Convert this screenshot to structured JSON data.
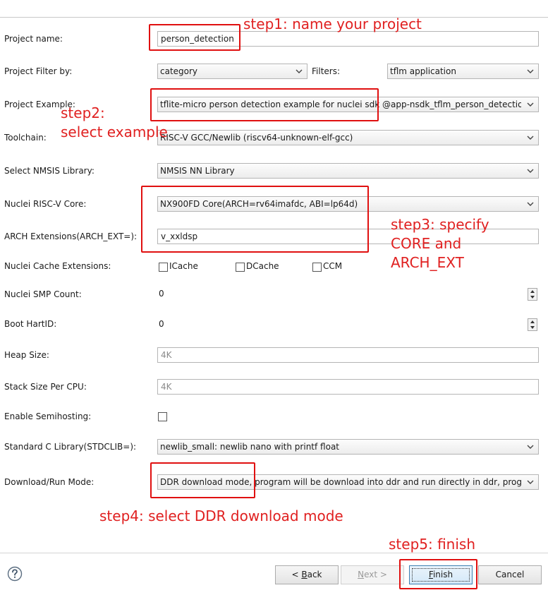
{
  "form": {
    "project_name": {
      "label": "Project name:",
      "value": "person_detection"
    },
    "project_filter": {
      "label": "Project Filter by:",
      "value": "category",
      "filters_label": "Filters:",
      "filters_value": "tflm application"
    },
    "project_example": {
      "label": "Project Example:",
      "value": "tflite-micro person detection example for nuclei sdk  @app-nsdk_tflm_person_detection"
    },
    "toolchain": {
      "label": "Toolchain:",
      "value": "RISC-V GCC/Newlib (riscv64-unknown-elf-gcc)"
    },
    "nmsis_library": {
      "label": "Select NMSIS Library:",
      "value": "NMSIS NN Library"
    },
    "core": {
      "label": "Nuclei RISC-V Core:",
      "value": "NX900FD Core(ARCH=rv64imafdc, ABI=lp64d)"
    },
    "arch_ext": {
      "label": "ARCH Extensions(ARCH_EXT=):",
      "value": "v_xxldsp"
    },
    "cache": {
      "label": "Nuclei Cache Extensions:",
      "options": [
        "ICache",
        "DCache",
        "CCM"
      ]
    },
    "smp_count": {
      "label": "Nuclei SMP Count:",
      "value": "0"
    },
    "boot_hartid": {
      "label": "Boot HartID:",
      "value": "0"
    },
    "heap_size": {
      "label": "Heap Size:",
      "value": "4K"
    },
    "stack_size": {
      "label": "Stack Size Per CPU:",
      "value": "4K"
    },
    "semihosting": {
      "label": "Enable Semihosting:",
      "checked": false
    },
    "stdclib": {
      "label": "Standard C Library(STDCLIB=):",
      "value": "newlib_small: newlib nano with printf float"
    },
    "download_mode": {
      "label": "Download/Run Mode:",
      "value": "DDR download mode, program will be download into ddr and run directly in ddr, program"
    }
  },
  "annotations": {
    "step1": "step1: name your project",
    "step2_line1": "step2:",
    "step2_line2": "select example",
    "step3_line1": "step3: specify",
    "step3_line2": "CORE and",
    "step3_line3": "ARCH_EXT",
    "step4": "step4: select DDR download mode",
    "step5": "step5: finish"
  },
  "buttons": {
    "back": {
      "prefix": "< ",
      "mnemonic": "B",
      "rest": "ack"
    },
    "next": {
      "mnemonic": "N",
      "rest": "ext >"
    },
    "finish": {
      "mnemonic": "F",
      "rest": "inish"
    },
    "cancel": "Cancel"
  },
  "icons": {
    "help": "help-icon",
    "dropdown": "chevron-down-icon",
    "spinner": "spinner-arrows-icon"
  },
  "colors": {
    "annotation": "#e02020",
    "default_button_border": "#3c7fb1"
  }
}
